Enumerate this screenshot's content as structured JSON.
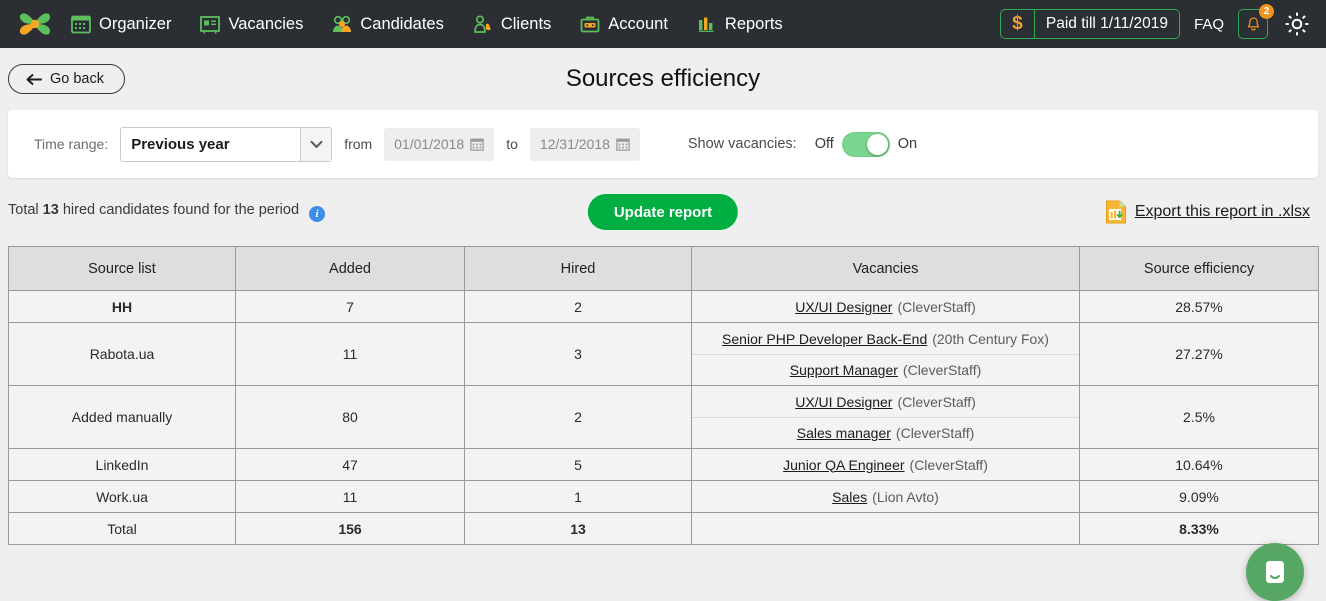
{
  "topnav": {
    "logo_name": "cleverstaff-logo",
    "items": [
      {
        "label": "Organizer",
        "icon": "calendar-icon"
      },
      {
        "label": "Vacancies",
        "icon": "id-card-icon"
      },
      {
        "label": "Candidates",
        "icon": "people-icon"
      },
      {
        "label": "Clients",
        "icon": "handshake-icon"
      },
      {
        "label": "Account",
        "icon": "briefcase-icon"
      },
      {
        "label": "Reports",
        "icon": "bar-chart-icon"
      }
    ],
    "paid_currency": "$",
    "paid_label": "Paid till 1/11/2019",
    "faq_label": "FAQ",
    "notification_count": "2",
    "settings_icon": "gear-icon"
  },
  "pagehead": {
    "back_label": "Go back",
    "title": "Sources efficiency"
  },
  "filters": {
    "time_range_label": "Time range:",
    "time_range_value": "Previous year",
    "from_label": "from",
    "date_from": "01/01/2018",
    "to_label": "to",
    "date_to": "12/31/2018",
    "show_vacancies_label": "Show vacancies:",
    "toggle_off_label": "Off",
    "toggle_on_label": "On",
    "toggle_state": "on"
  },
  "actions": {
    "total_prefix": "Total ",
    "total_count": "13",
    "total_suffix": " hired candidates found for the period",
    "info_glyph": "i",
    "update_label": "Update report",
    "export_label": " Export this report in .xlsx",
    "export_icon": "xlsx-download-icon"
  },
  "table": {
    "headers": [
      "Source list",
      "Added",
      "Hired",
      "Vacancies",
      "Source efficiency"
    ],
    "rows": [
      {
        "source": "HH",
        "bold_source": true,
        "added": "7",
        "hired": "2",
        "vacancies": [
          {
            "title": "UX/UI Designer",
            "company": "(CleverStaff)"
          }
        ],
        "efficiency": "28.57%"
      },
      {
        "source": "Rabota.ua",
        "bold_source": false,
        "added": "11",
        "hired": "3",
        "vacancies": [
          {
            "title": "Senior PHP Developer Back-End",
            "company": "(20th Century Fox)"
          },
          {
            "title": "Support Manager",
            "company": "(CleverStaff)"
          }
        ],
        "efficiency": "27.27%"
      },
      {
        "source": "Added manually",
        "bold_source": false,
        "added": "80",
        "hired": "2",
        "vacancies": [
          {
            "title": "UX/UI Designer",
            "company": "(CleverStaff)"
          },
          {
            "title": "Sales manager",
            "company": "(CleverStaff)"
          }
        ],
        "efficiency": "2.5%"
      },
      {
        "source": "LinkedIn",
        "bold_source": false,
        "added": "47",
        "hired": "5",
        "vacancies": [
          {
            "title": "Junior QA Engineer",
            "company": "(CleverStaff)"
          }
        ],
        "efficiency": "10.64%"
      },
      {
        "source": "Work.ua",
        "bold_source": false,
        "added": "11",
        "hired": "1",
        "vacancies": [
          {
            "title": "Sales",
            "company": "(Lion Avto)"
          }
        ],
        "efficiency": "9.09%"
      },
      {
        "source": "Total",
        "bold_source": false,
        "added": "156",
        "hired": "13",
        "bold_numbers": true,
        "vacancies": [],
        "efficiency": "8.33%"
      }
    ]
  },
  "chat": {
    "icon": "chat-smiley-icon"
  },
  "colors": {
    "nav_bg": "#2b2f33",
    "accent_green": "#00ae42",
    "accent_orange": "#f0941f",
    "toggle_green": "#7ad58e",
    "page_bg": "#efefef",
    "table_header": "#dedede"
  }
}
